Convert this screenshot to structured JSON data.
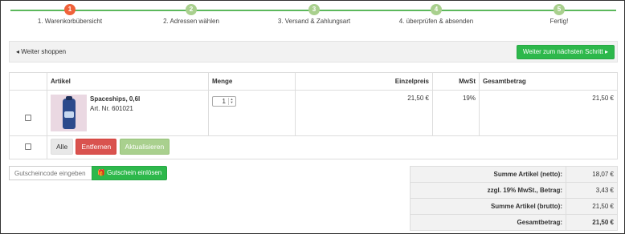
{
  "progress": {
    "steps": [
      {
        "number": "1",
        "label": "1. Warenkorbübersicht",
        "active": true
      },
      {
        "number": "2",
        "label": "2. Adressen wählen",
        "active": false
      },
      {
        "number": "3",
        "label": "3. Versand & Zahlungsart",
        "active": false
      },
      {
        "number": "4",
        "label": "4. überprüfen & absenden",
        "active": false
      },
      {
        "number": "5",
        "label": "Fertig!",
        "active": false
      }
    ],
    "active_color": "#f0623a",
    "inactive_color": "#a9d08e",
    "line_color": "#5cb85c"
  },
  "toolbar": {
    "continue_shopping": "◂ Weiter shoppen",
    "next_step": "Weiter zum nächsten Schritt ▸"
  },
  "cart": {
    "headers": {
      "article": "Artikel",
      "quantity": "Menge",
      "unit_price": "Einzelpreis",
      "vat": "MwSt",
      "total": "Gesamtbetrag"
    },
    "items": [
      {
        "name": "Spaceships, 0,6l",
        "article_number": "Art. Nr. 601021",
        "quantity": "1",
        "unit_price": "21,50 €",
        "vat": "19%",
        "total": "21,50 €"
      }
    ],
    "actions": {
      "all": "Alle",
      "remove": "Entfernen",
      "update": "Aktualisieren"
    }
  },
  "voucher": {
    "placeholder": "Gutscheincode eingeben",
    "redeem_label": "🎁 Gutschein einlösen"
  },
  "totals": [
    {
      "label": "Summe Artikel (netto):",
      "value": "18,07 €"
    },
    {
      "label": "zzgl. 19% MwSt., Betrag:",
      "value": "3,43 €"
    },
    {
      "label": "Summe Artikel (brutto):",
      "value": "21,50 €"
    },
    {
      "label": "Gesamtbetrag:",
      "value": "21,50 €"
    }
  ],
  "colors": {
    "primary_green": "#2db84b",
    "danger_red": "#d9534f",
    "light_green": "#a9d08e"
  }
}
